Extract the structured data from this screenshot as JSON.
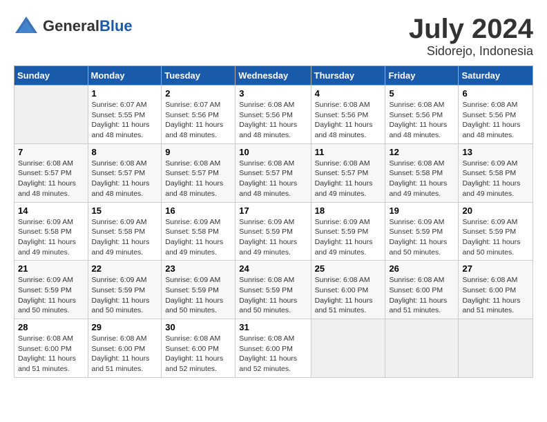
{
  "header": {
    "logo_general": "General",
    "logo_blue": "Blue",
    "month_year": "July 2024",
    "location": "Sidorejo, Indonesia"
  },
  "days_of_week": [
    "Sunday",
    "Monday",
    "Tuesday",
    "Wednesday",
    "Thursday",
    "Friday",
    "Saturday"
  ],
  "weeks": [
    [
      {
        "num": "",
        "empty": true
      },
      {
        "num": "1",
        "sunrise": "Sunrise: 6:07 AM",
        "sunset": "Sunset: 5:55 PM",
        "daylight": "Daylight: 11 hours and 48 minutes."
      },
      {
        "num": "2",
        "sunrise": "Sunrise: 6:07 AM",
        "sunset": "Sunset: 5:56 PM",
        "daylight": "Daylight: 11 hours and 48 minutes."
      },
      {
        "num": "3",
        "sunrise": "Sunrise: 6:08 AM",
        "sunset": "Sunset: 5:56 PM",
        "daylight": "Daylight: 11 hours and 48 minutes."
      },
      {
        "num": "4",
        "sunrise": "Sunrise: 6:08 AM",
        "sunset": "Sunset: 5:56 PM",
        "daylight": "Daylight: 11 hours and 48 minutes."
      },
      {
        "num": "5",
        "sunrise": "Sunrise: 6:08 AM",
        "sunset": "Sunset: 5:56 PM",
        "daylight": "Daylight: 11 hours and 48 minutes."
      },
      {
        "num": "6",
        "sunrise": "Sunrise: 6:08 AM",
        "sunset": "Sunset: 5:56 PM",
        "daylight": "Daylight: 11 hours and 48 minutes."
      }
    ],
    [
      {
        "num": "7",
        "sunrise": "Sunrise: 6:08 AM",
        "sunset": "Sunset: 5:57 PM",
        "daylight": "Daylight: 11 hours and 48 minutes."
      },
      {
        "num": "8",
        "sunrise": "Sunrise: 6:08 AM",
        "sunset": "Sunset: 5:57 PM",
        "daylight": "Daylight: 11 hours and 48 minutes."
      },
      {
        "num": "9",
        "sunrise": "Sunrise: 6:08 AM",
        "sunset": "Sunset: 5:57 PM",
        "daylight": "Daylight: 11 hours and 48 minutes."
      },
      {
        "num": "10",
        "sunrise": "Sunrise: 6:08 AM",
        "sunset": "Sunset: 5:57 PM",
        "daylight": "Daylight: 11 hours and 48 minutes."
      },
      {
        "num": "11",
        "sunrise": "Sunrise: 6:08 AM",
        "sunset": "Sunset: 5:57 PM",
        "daylight": "Daylight: 11 hours and 49 minutes."
      },
      {
        "num": "12",
        "sunrise": "Sunrise: 6:08 AM",
        "sunset": "Sunset: 5:58 PM",
        "daylight": "Daylight: 11 hours and 49 minutes."
      },
      {
        "num": "13",
        "sunrise": "Sunrise: 6:09 AM",
        "sunset": "Sunset: 5:58 PM",
        "daylight": "Daylight: 11 hours and 49 minutes."
      }
    ],
    [
      {
        "num": "14",
        "sunrise": "Sunrise: 6:09 AM",
        "sunset": "Sunset: 5:58 PM",
        "daylight": "Daylight: 11 hours and 49 minutes."
      },
      {
        "num": "15",
        "sunrise": "Sunrise: 6:09 AM",
        "sunset": "Sunset: 5:58 PM",
        "daylight": "Daylight: 11 hours and 49 minutes."
      },
      {
        "num": "16",
        "sunrise": "Sunrise: 6:09 AM",
        "sunset": "Sunset: 5:58 PM",
        "daylight": "Daylight: 11 hours and 49 minutes."
      },
      {
        "num": "17",
        "sunrise": "Sunrise: 6:09 AM",
        "sunset": "Sunset: 5:59 PM",
        "daylight": "Daylight: 11 hours and 49 minutes."
      },
      {
        "num": "18",
        "sunrise": "Sunrise: 6:09 AM",
        "sunset": "Sunset: 5:59 PM",
        "daylight": "Daylight: 11 hours and 49 minutes."
      },
      {
        "num": "19",
        "sunrise": "Sunrise: 6:09 AM",
        "sunset": "Sunset: 5:59 PM",
        "daylight": "Daylight: 11 hours and 50 minutes."
      },
      {
        "num": "20",
        "sunrise": "Sunrise: 6:09 AM",
        "sunset": "Sunset: 5:59 PM",
        "daylight": "Daylight: 11 hours and 50 minutes."
      }
    ],
    [
      {
        "num": "21",
        "sunrise": "Sunrise: 6:09 AM",
        "sunset": "Sunset: 5:59 PM",
        "daylight": "Daylight: 11 hours and 50 minutes."
      },
      {
        "num": "22",
        "sunrise": "Sunrise: 6:09 AM",
        "sunset": "Sunset: 5:59 PM",
        "daylight": "Daylight: 11 hours and 50 minutes."
      },
      {
        "num": "23",
        "sunrise": "Sunrise: 6:09 AM",
        "sunset": "Sunset: 5:59 PM",
        "daylight": "Daylight: 11 hours and 50 minutes."
      },
      {
        "num": "24",
        "sunrise": "Sunrise: 6:08 AM",
        "sunset": "Sunset: 5:59 PM",
        "daylight": "Daylight: 11 hours and 50 minutes."
      },
      {
        "num": "25",
        "sunrise": "Sunrise: 6:08 AM",
        "sunset": "Sunset: 6:00 PM",
        "daylight": "Daylight: 11 hours and 51 minutes."
      },
      {
        "num": "26",
        "sunrise": "Sunrise: 6:08 AM",
        "sunset": "Sunset: 6:00 PM",
        "daylight": "Daylight: 11 hours and 51 minutes."
      },
      {
        "num": "27",
        "sunrise": "Sunrise: 6:08 AM",
        "sunset": "Sunset: 6:00 PM",
        "daylight": "Daylight: 11 hours and 51 minutes."
      }
    ],
    [
      {
        "num": "28",
        "sunrise": "Sunrise: 6:08 AM",
        "sunset": "Sunset: 6:00 PM",
        "daylight": "Daylight: 11 hours and 51 minutes."
      },
      {
        "num": "29",
        "sunrise": "Sunrise: 6:08 AM",
        "sunset": "Sunset: 6:00 PM",
        "daylight": "Daylight: 11 hours and 51 minutes."
      },
      {
        "num": "30",
        "sunrise": "Sunrise: 6:08 AM",
        "sunset": "Sunset: 6:00 PM",
        "daylight": "Daylight: 11 hours and 52 minutes."
      },
      {
        "num": "31",
        "sunrise": "Sunrise: 6:08 AM",
        "sunset": "Sunset: 6:00 PM",
        "daylight": "Daylight: 11 hours and 52 minutes."
      },
      {
        "num": "",
        "empty": true
      },
      {
        "num": "",
        "empty": true
      },
      {
        "num": "",
        "empty": true
      }
    ]
  ]
}
